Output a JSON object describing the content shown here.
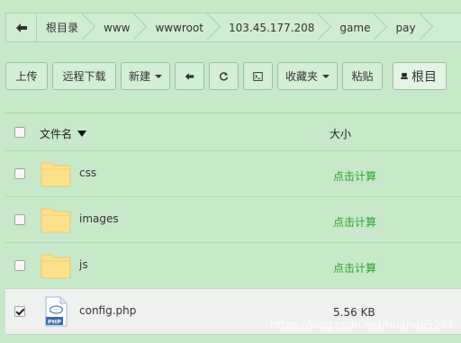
{
  "breadcrumb": {
    "items": [
      "根目录",
      "www",
      "wwwroot",
      "103.45.177.208",
      "game",
      "pay"
    ]
  },
  "toolbar": {
    "upload": "上传",
    "remote_download": "远程下载",
    "new": "新建",
    "favorites": "收藏夹",
    "paste": "粘贴",
    "root": "根目"
  },
  "table": {
    "headers": {
      "name": "文件名",
      "size": "大小"
    },
    "rows": [
      {
        "name": "css",
        "type": "folder",
        "size": "点击计算",
        "checked": false
      },
      {
        "name": "images",
        "type": "folder",
        "size": "点击计算",
        "checked": false
      },
      {
        "name": "js",
        "type": "folder",
        "size": "点击计算",
        "checked": false
      },
      {
        "name": "config.php",
        "type": "php",
        "size": "5.56 KB",
        "checked": true
      }
    ]
  },
  "icons": {
    "back": "arrow-left-icon",
    "refresh": "refresh-icon",
    "terminal": "terminal-icon",
    "drive": "drive-icon",
    "folder": "folder-icon",
    "php_file": "php-file-icon"
  },
  "colors": {
    "background": "#c7e8c9",
    "link_green": "#2aa52a",
    "folder": "#fde08a"
  },
  "watermark": "https://blog.csdn.net/huahua5284"
}
